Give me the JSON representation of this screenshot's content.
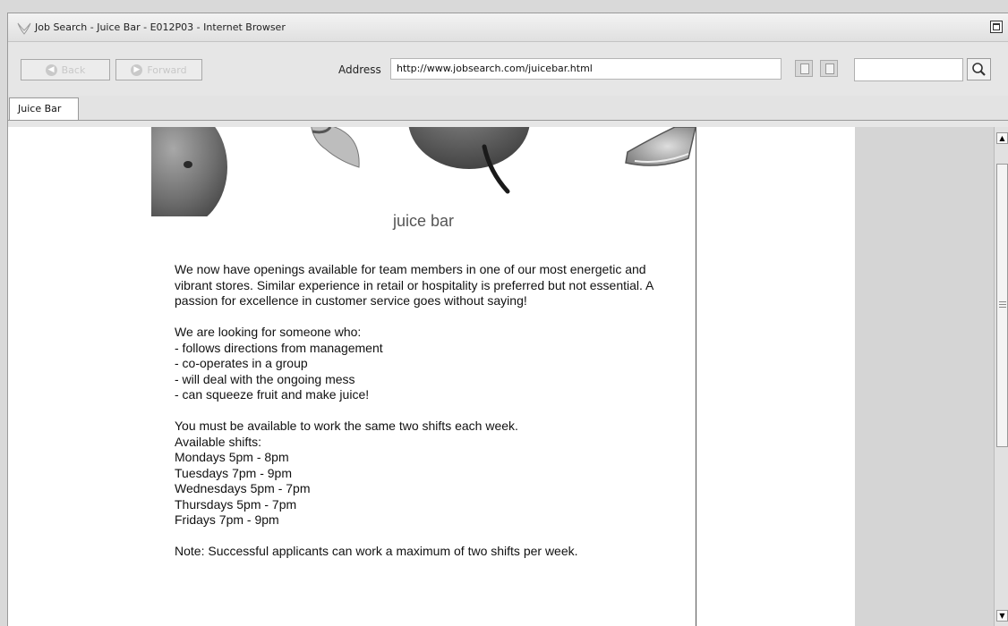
{
  "window": {
    "title": "Job Search - Juice Bar - E012P03 - Internet Browser"
  },
  "toolbar": {
    "back_label": "Back",
    "forward_label": "Forward",
    "address_label": "Address",
    "address_value": "http://www.jobsearch.com/juicebar.html",
    "search_value": ""
  },
  "tabs": [
    {
      "label": "Juice Bar"
    }
  ],
  "page": {
    "heading": "juice bar",
    "intro": "We now have openings available for team members in one of our most energetic and vibrant stores. Similar experience in retail or hospitality is preferred but not essential. A passion for excellence in customer service goes without saying!",
    "looking_for_title": "We are looking for someone who:",
    "requirements": [
      "- follows directions from management",
      "- co-operates in a group",
      "- will deal with the ongoing mess",
      "- can squeeze fruit and make juice!"
    ],
    "availability": "You must be available to work the same two shifts each week.",
    "shifts_title": "Available shifts:",
    "shifts": [
      "Mondays 5pm - 8pm",
      "Tuesdays 7pm - 9pm",
      "Wednesdays 5pm - 7pm",
      "Thursdays 5pm - 7pm",
      "Fridays 7pm - 9pm"
    ],
    "note": "Note: Successful applicants can work a maximum of two shifts per week."
  },
  "icons": {
    "app": "browser-logo-icon",
    "maximize": "maximize-icon",
    "back": "back-arrow-icon",
    "forward": "forward-arrow-icon",
    "copy": "copy-icon",
    "paste": "paste-icon",
    "search": "magnifier-icon",
    "scroll_up": "scroll-up-arrow-icon",
    "scroll_down": "scroll-down-arrow-icon"
  }
}
